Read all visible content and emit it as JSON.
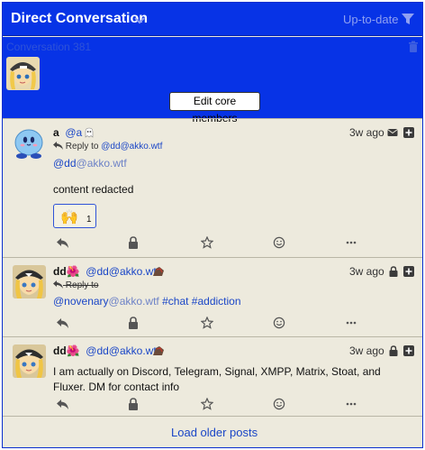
{
  "header": {
    "title": "Direct Conversation",
    "status": "Up-to-date"
  },
  "conversation": {
    "name": "Conversation 381",
    "edit_button": "Edit core members"
  },
  "statuses": [
    {
      "display_name": "a",
      "handle": "@a",
      "time": "3w ago",
      "reply_label": "Reply to",
      "reply_handle": "@dd@akko.wtf",
      "mention_user": "@dd",
      "mention_domain": "@akko.wtf",
      "body": "content redacted",
      "reaction_emoji": "🙌",
      "reaction_count": "1"
    },
    {
      "display_name": "dd🌺",
      "handle": "@dd@akko.wtf",
      "time": "3w ago",
      "reply_label": "Reply to",
      "mention_user": "@novenary",
      "mention_domain": "@akko.wtf",
      "tag1": "#chat",
      "tag2": "#addiction"
    },
    {
      "display_name": "dd🌺",
      "handle": "@dd@akko.wtf",
      "time": "3w ago",
      "body": "I am actually on Discord, Telegram, Signal, XMPP, Matrix, Stoat, and Fluxer. DM for contact info"
    }
  ],
  "load_more": "Load older posts",
  "colors": {
    "header_bg": "#0733e6",
    "panel_bg": "#edeadd",
    "link": "#1a46c7"
  }
}
